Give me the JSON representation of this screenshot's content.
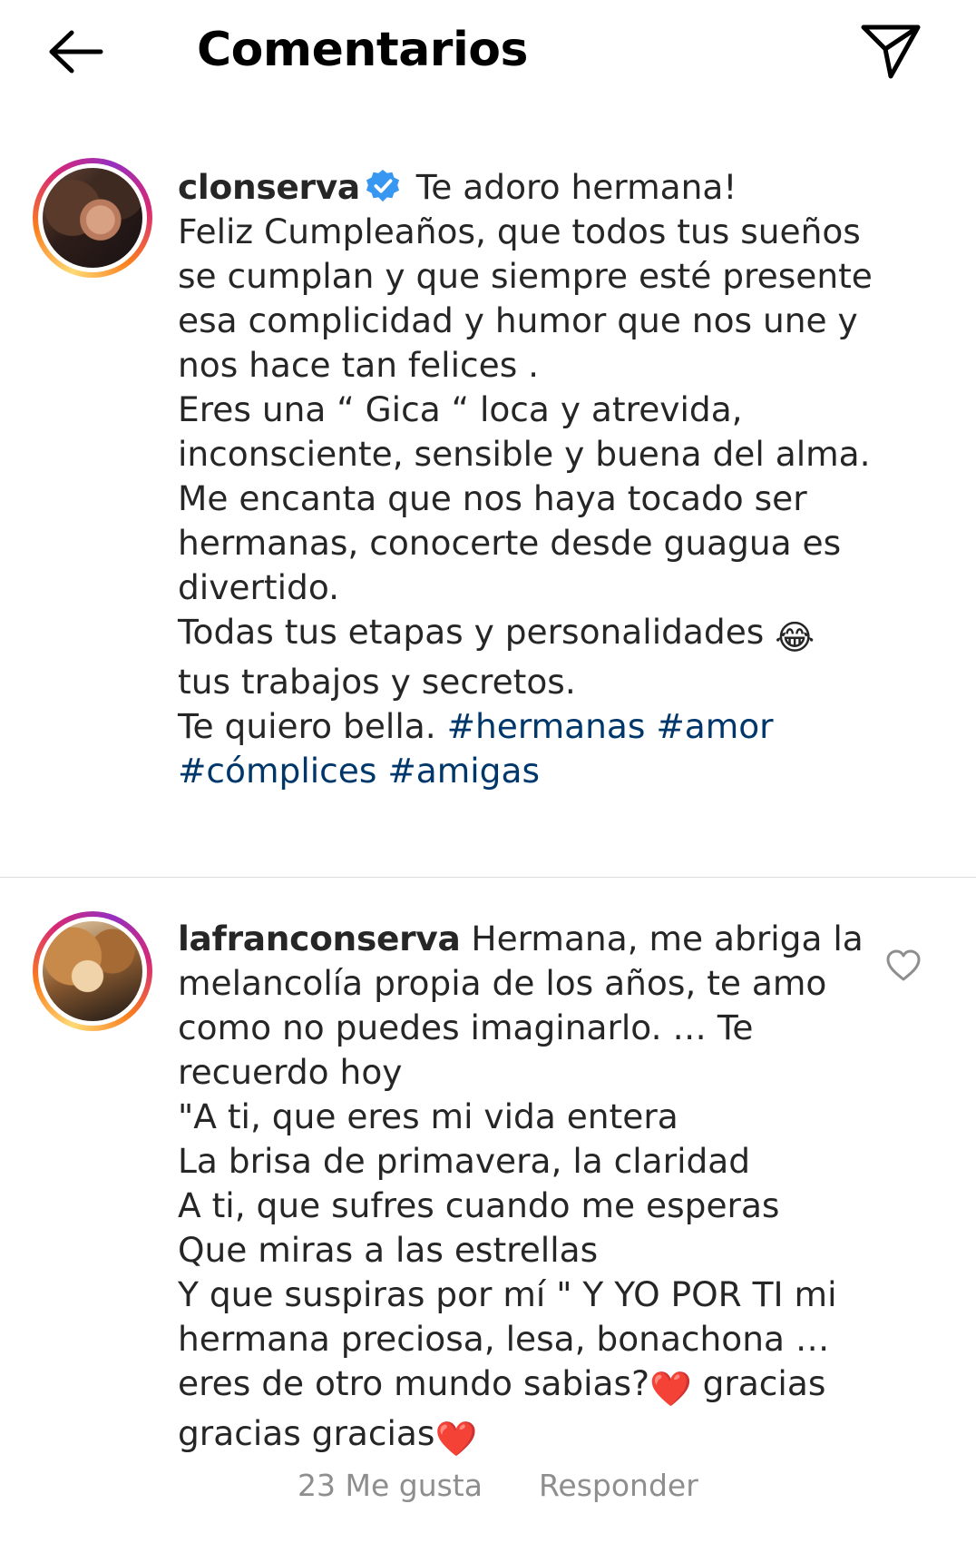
{
  "header": {
    "title": "Comentarios"
  },
  "comments": [
    {
      "username": "clonserva",
      "verified": true,
      "first_line": " Te adoro hermana!",
      "body": "Feliz Cumpleaños, que todos tus sueños se cumplan y que siempre esté presente esa complicidad y humor que nos une y nos hace tan felices .\nEres una “ Gica “ loca y atrevida, inconsciente, sensible y buena del alma.\nMe encanta que nos haya tocado ser hermanas, conocerte desde guagua es divertido.\nTodas tus etapas y personalidades ",
      "emoji": "😂",
      "body2": "\ntus trabajos y secretos.\nTe quiero bella. ",
      "hashtags": [
        "#hermanas",
        "#amor",
        "#cómplices",
        "#amigas"
      ]
    },
    {
      "username": "lafranconserva",
      "text": " Hermana, me abriga la melancolía propia de los años, te amo como no puedes imaginarlo. … Te recuerdo hoy\n\"A ti, que eres mi vida entera\nLa brisa de primavera, la claridad\nA ti, que sufres cuando me esperas\nQue miras a las estrellas\nY que suspiras por mí \" Y YO POR TI mi hermana preciosa, lesa, bonachona … eres de otro mundo sabias?",
      "heart1": "❤️",
      "text2": " gracias gracias gracias",
      "heart2": "❤️",
      "likes": "23 Me gusta",
      "reply_label": "Responder"
    }
  ],
  "colors": {
    "hashtag": "#00376b",
    "verified": "#3897f0",
    "meta": "#8e8e8e"
  }
}
